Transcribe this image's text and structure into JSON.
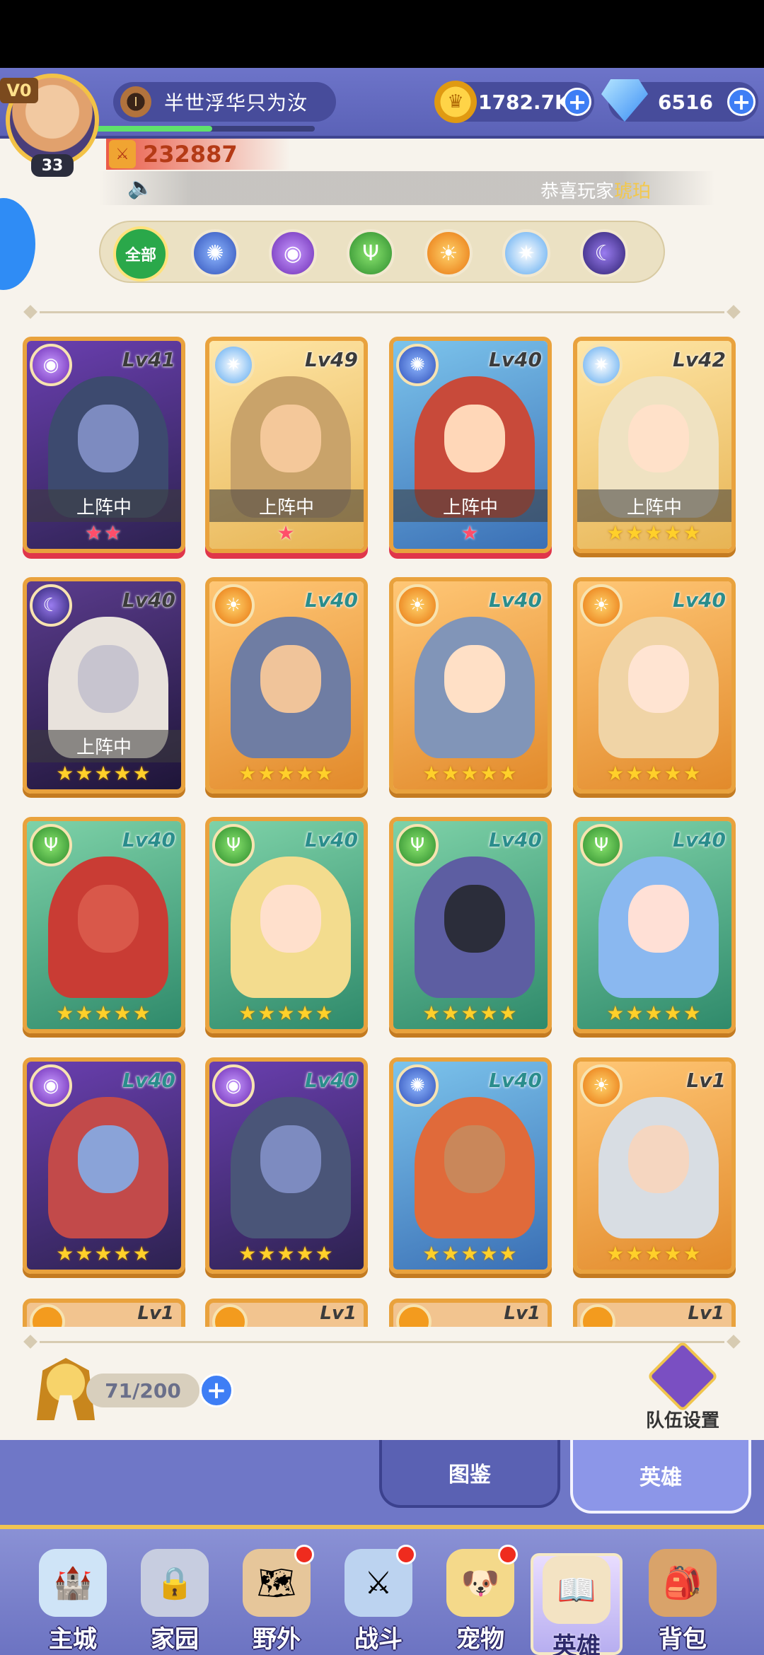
{
  "player": {
    "vip": "V0",
    "level": "33",
    "name": "半世浮华只为汝",
    "rank_icon": "I",
    "power": "232887",
    "exp_fraction": 0.54
  },
  "resources": {
    "gold": "1782.7K",
    "gems": "6516"
  },
  "notice": {
    "prefix": "恭喜玩家",
    "highlight": "琥珀"
  },
  "filters": {
    "all_label": "全部",
    "items": [
      "water-wave",
      "void-eye",
      "nature-antler",
      "sun",
      "light-star",
      "moon"
    ]
  },
  "heroes": [
    {
      "level": "Lv41",
      "element": "eye",
      "status": "上阵中",
      "stars": "★★",
      "star_color": "pink"
    },
    {
      "level": "Lv49",
      "element": "light",
      "status": "上阵中",
      "stars": "★",
      "star_color": "pink"
    },
    {
      "level": "Lv40",
      "element": "water",
      "status": "上阵中",
      "stars": "★",
      "star_color": "pink"
    },
    {
      "level": "Lv42",
      "element": "light",
      "status": "上阵中",
      "stars": "★★★★★",
      "star_color": "gold"
    },
    {
      "level": "Lv40",
      "element": "moon",
      "status": "上阵中",
      "stars": "★★★★★",
      "star_color": "gold"
    },
    {
      "level": "Lv40",
      "element": "sun",
      "status": "",
      "stars": "★★★★★",
      "star_color": "gold"
    },
    {
      "level": "Lv40",
      "element": "sun",
      "status": "",
      "stars": "★★★★★",
      "star_color": "gold"
    },
    {
      "level": "Lv40",
      "element": "sun",
      "status": "",
      "stars": "★★★★★",
      "star_color": "gold"
    },
    {
      "level": "Lv40",
      "element": "nature",
      "status": "",
      "stars": "★★★★★",
      "star_color": "gold"
    },
    {
      "level": "Lv40",
      "element": "nature",
      "status": "",
      "stars": "★★★★★",
      "star_color": "gold"
    },
    {
      "level": "Lv40",
      "element": "nature",
      "status": "",
      "stars": "★★★★★",
      "star_color": "gold"
    },
    {
      "level": "Lv40",
      "element": "nature",
      "status": "",
      "stars": "★★★★★",
      "star_color": "gold"
    },
    {
      "level": "Lv40",
      "element": "eye",
      "status": "",
      "stars": "★★★★★",
      "star_color": "gold"
    },
    {
      "level": "Lv40",
      "element": "eye",
      "status": "",
      "stars": "★★★★★",
      "star_color": "gold"
    },
    {
      "level": "Lv40",
      "element": "water",
      "status": "",
      "stars": "★★★★★",
      "star_color": "gold"
    },
    {
      "level": "Lv1",
      "element": "sun",
      "status": "",
      "stars": "★★★★★",
      "star_color": "gold"
    }
  ],
  "partial_heroes": [
    "Lv1",
    "Lv1",
    "Lv1",
    "Lv1"
  ],
  "roster": {
    "count": "71/200",
    "team_setup_label": "队伍设置"
  },
  "sub_tabs": {
    "codex": "图鉴",
    "hero": "英雄"
  },
  "nav": {
    "items": [
      "主城",
      "家园",
      "野外",
      "战斗",
      "宠物",
      "英雄",
      "背包"
    ]
  },
  "colors": {
    "panel_bg": "#f7f3ec",
    "header_bg": "#6d74c9",
    "card_border": "#e9a23d",
    "accent_blue": "#3e7ef5"
  }
}
